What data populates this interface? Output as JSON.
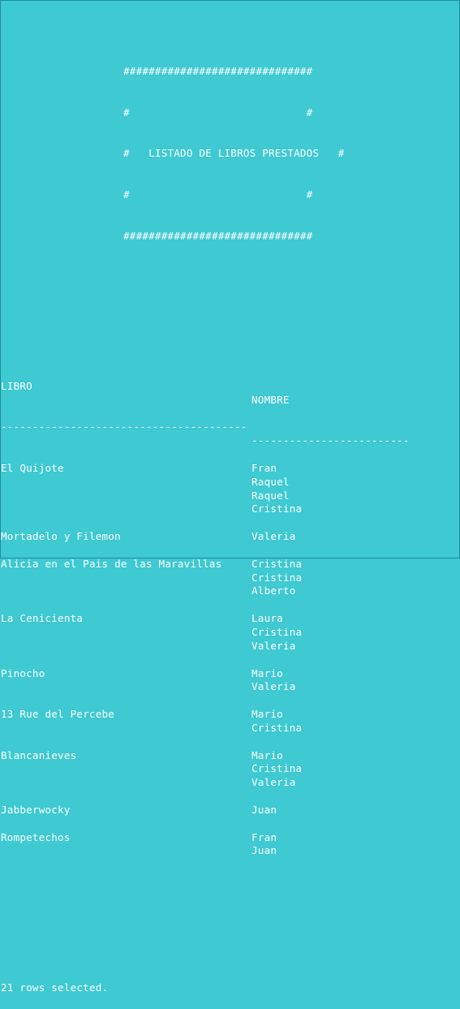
{
  "banner": {
    "border": "##############################",
    "blank": "#                            #",
    "title": "#   LISTADO DE LIBROS PRESTADOS   #"
  },
  "headers": {
    "libro": "LIBRO",
    "nombre": "NOMBRE",
    "libro_rule": "---------------------------------------",
    "nombre_rule": "-------------------------"
  },
  "rows": [
    {
      "libro": "El Quijote",
      "nombre": "Fran"
    },
    {
      "libro": "",
      "nombre": "Raquel"
    },
    {
      "libro": "",
      "nombre": "Raquel"
    },
    {
      "libro": "",
      "nombre": "Cristina"
    },
    {
      "libro": "",
      "nombre": ""
    },
    {
      "libro": "Mortadelo y Filemon",
      "nombre": "Valeria"
    },
    {
      "libro": "",
      "nombre": ""
    },
    {
      "libro": "Alicia en el Pais de las Maravillas",
      "nombre": "Cristina"
    },
    {
      "libro": "",
      "nombre": "Cristina"
    },
    {
      "libro": "",
      "nombre": "Alberto"
    },
    {
      "libro": "",
      "nombre": ""
    },
    {
      "libro": "La Cenicienta",
      "nombre": "Laura"
    },
    {
      "libro": "",
      "nombre": "Cristina"
    },
    {
      "libro": "",
      "nombre": "Valeria"
    },
    {
      "libro": "",
      "nombre": ""
    },
    {
      "libro": "Pinocho",
      "nombre": "Mario"
    },
    {
      "libro": "",
      "nombre": "Valeria"
    },
    {
      "libro": "",
      "nombre": ""
    },
    {
      "libro": "13 Rue del Percebe",
      "nombre": "Mario"
    },
    {
      "libro": "",
      "nombre": "Cristina"
    },
    {
      "libro": "",
      "nombre": ""
    },
    {
      "libro": "Blancanieves",
      "nombre": "Mario"
    },
    {
      "libro": "",
      "nombre": "Cristina"
    },
    {
      "libro": "",
      "nombre": "Valeria"
    },
    {
      "libro": "",
      "nombre": ""
    },
    {
      "libro": "Jabberwocky",
      "nombre": "Juan"
    },
    {
      "libro": "",
      "nombre": ""
    },
    {
      "libro": "Rompetechos",
      "nombre": "Fran"
    },
    {
      "libro": "",
      "nombre": "Juan"
    }
  ],
  "footer": {
    "status": "21 rows selected."
  },
  "colors": {
    "background": "#3ec9d3",
    "text": "#ffffff"
  }
}
